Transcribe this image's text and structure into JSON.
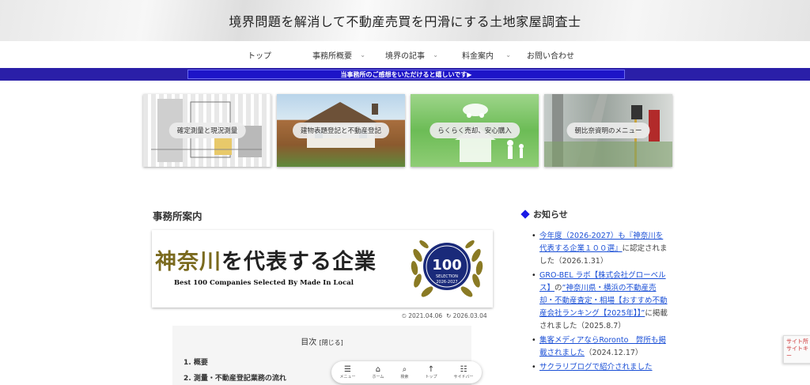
{
  "header": {
    "site_title": "境界問題を解消して不動産売買を円滑にする土地家屋調査士"
  },
  "nav": {
    "items": [
      {
        "label": "トップ",
        "has_dropdown": false
      },
      {
        "label": "事務所概要",
        "has_dropdown": true
      },
      {
        "label": "境界の記事",
        "has_dropdown": true
      },
      {
        "label": "料金案内",
        "has_dropdown": true
      },
      {
        "label": "お問い合わせ",
        "has_dropdown": false
      }
    ]
  },
  "banner": {
    "text": "当事務所のご感想をいただけると嬉しいです▶"
  },
  "cards": [
    {
      "label": "確定測量と現況測量"
    },
    {
      "label": "建物表題登記と不動産登記"
    },
    {
      "label": "らくらく売却、安心購入"
    },
    {
      "label": "朝比奈資明のメニュー"
    }
  ],
  "main": {
    "title": "事務所案内",
    "hero": {
      "title_part1": "神奈川",
      "title_part2": "を代表する企業",
      "subtitle": "Best 100 Companies Selected By Made In Local",
      "emblem_number": "100",
      "emblem_line1": "SELECTION",
      "emblem_line2": "2026-2027"
    },
    "published": "2021.04.06",
    "updated": "2026.03.04",
    "toc": {
      "title": "目次",
      "toggle": "[閉じる]",
      "items": [
        "1. 概要",
        "2. 測量・不動産登記業務の流れ"
      ]
    }
  },
  "mobile_bar": {
    "items": [
      {
        "icon": "menu-icon",
        "label": "メニュー"
      },
      {
        "icon": "home-icon",
        "label": "ホーム"
      },
      {
        "icon": "search-icon",
        "label": "検索"
      },
      {
        "icon": "arrow-up-icon",
        "label": "トップ"
      },
      {
        "icon": "sidebar-icon",
        "label": "サイドバー"
      }
    ]
  },
  "sidebar": {
    "heading": "お知らせ",
    "news": [
      {
        "link": "今年度（2026-2027）も『神奈川を代表する企業１００選』",
        "text": "に認定されました（2026.1.31）"
      },
      {
        "link": "GRO-BEL ラボ【株式会社グローベルス】",
        "text": "の",
        "link2": "”神奈川県・横浜の不動産売却・不動産査定・相場【おすすめ不動産会社ランキング【2025年】】”",
        "text2": "に掲載されました（2025.8.7）"
      },
      {
        "link": "集客メディアならRoronto　弊所も掲載されました",
        "text": "（2024.12.17）"
      },
      {
        "link": "サクラリブログで紹介されました",
        "text": ""
      }
    ]
  },
  "recaptcha": {
    "text": "サイト所サイトキー"
  }
}
